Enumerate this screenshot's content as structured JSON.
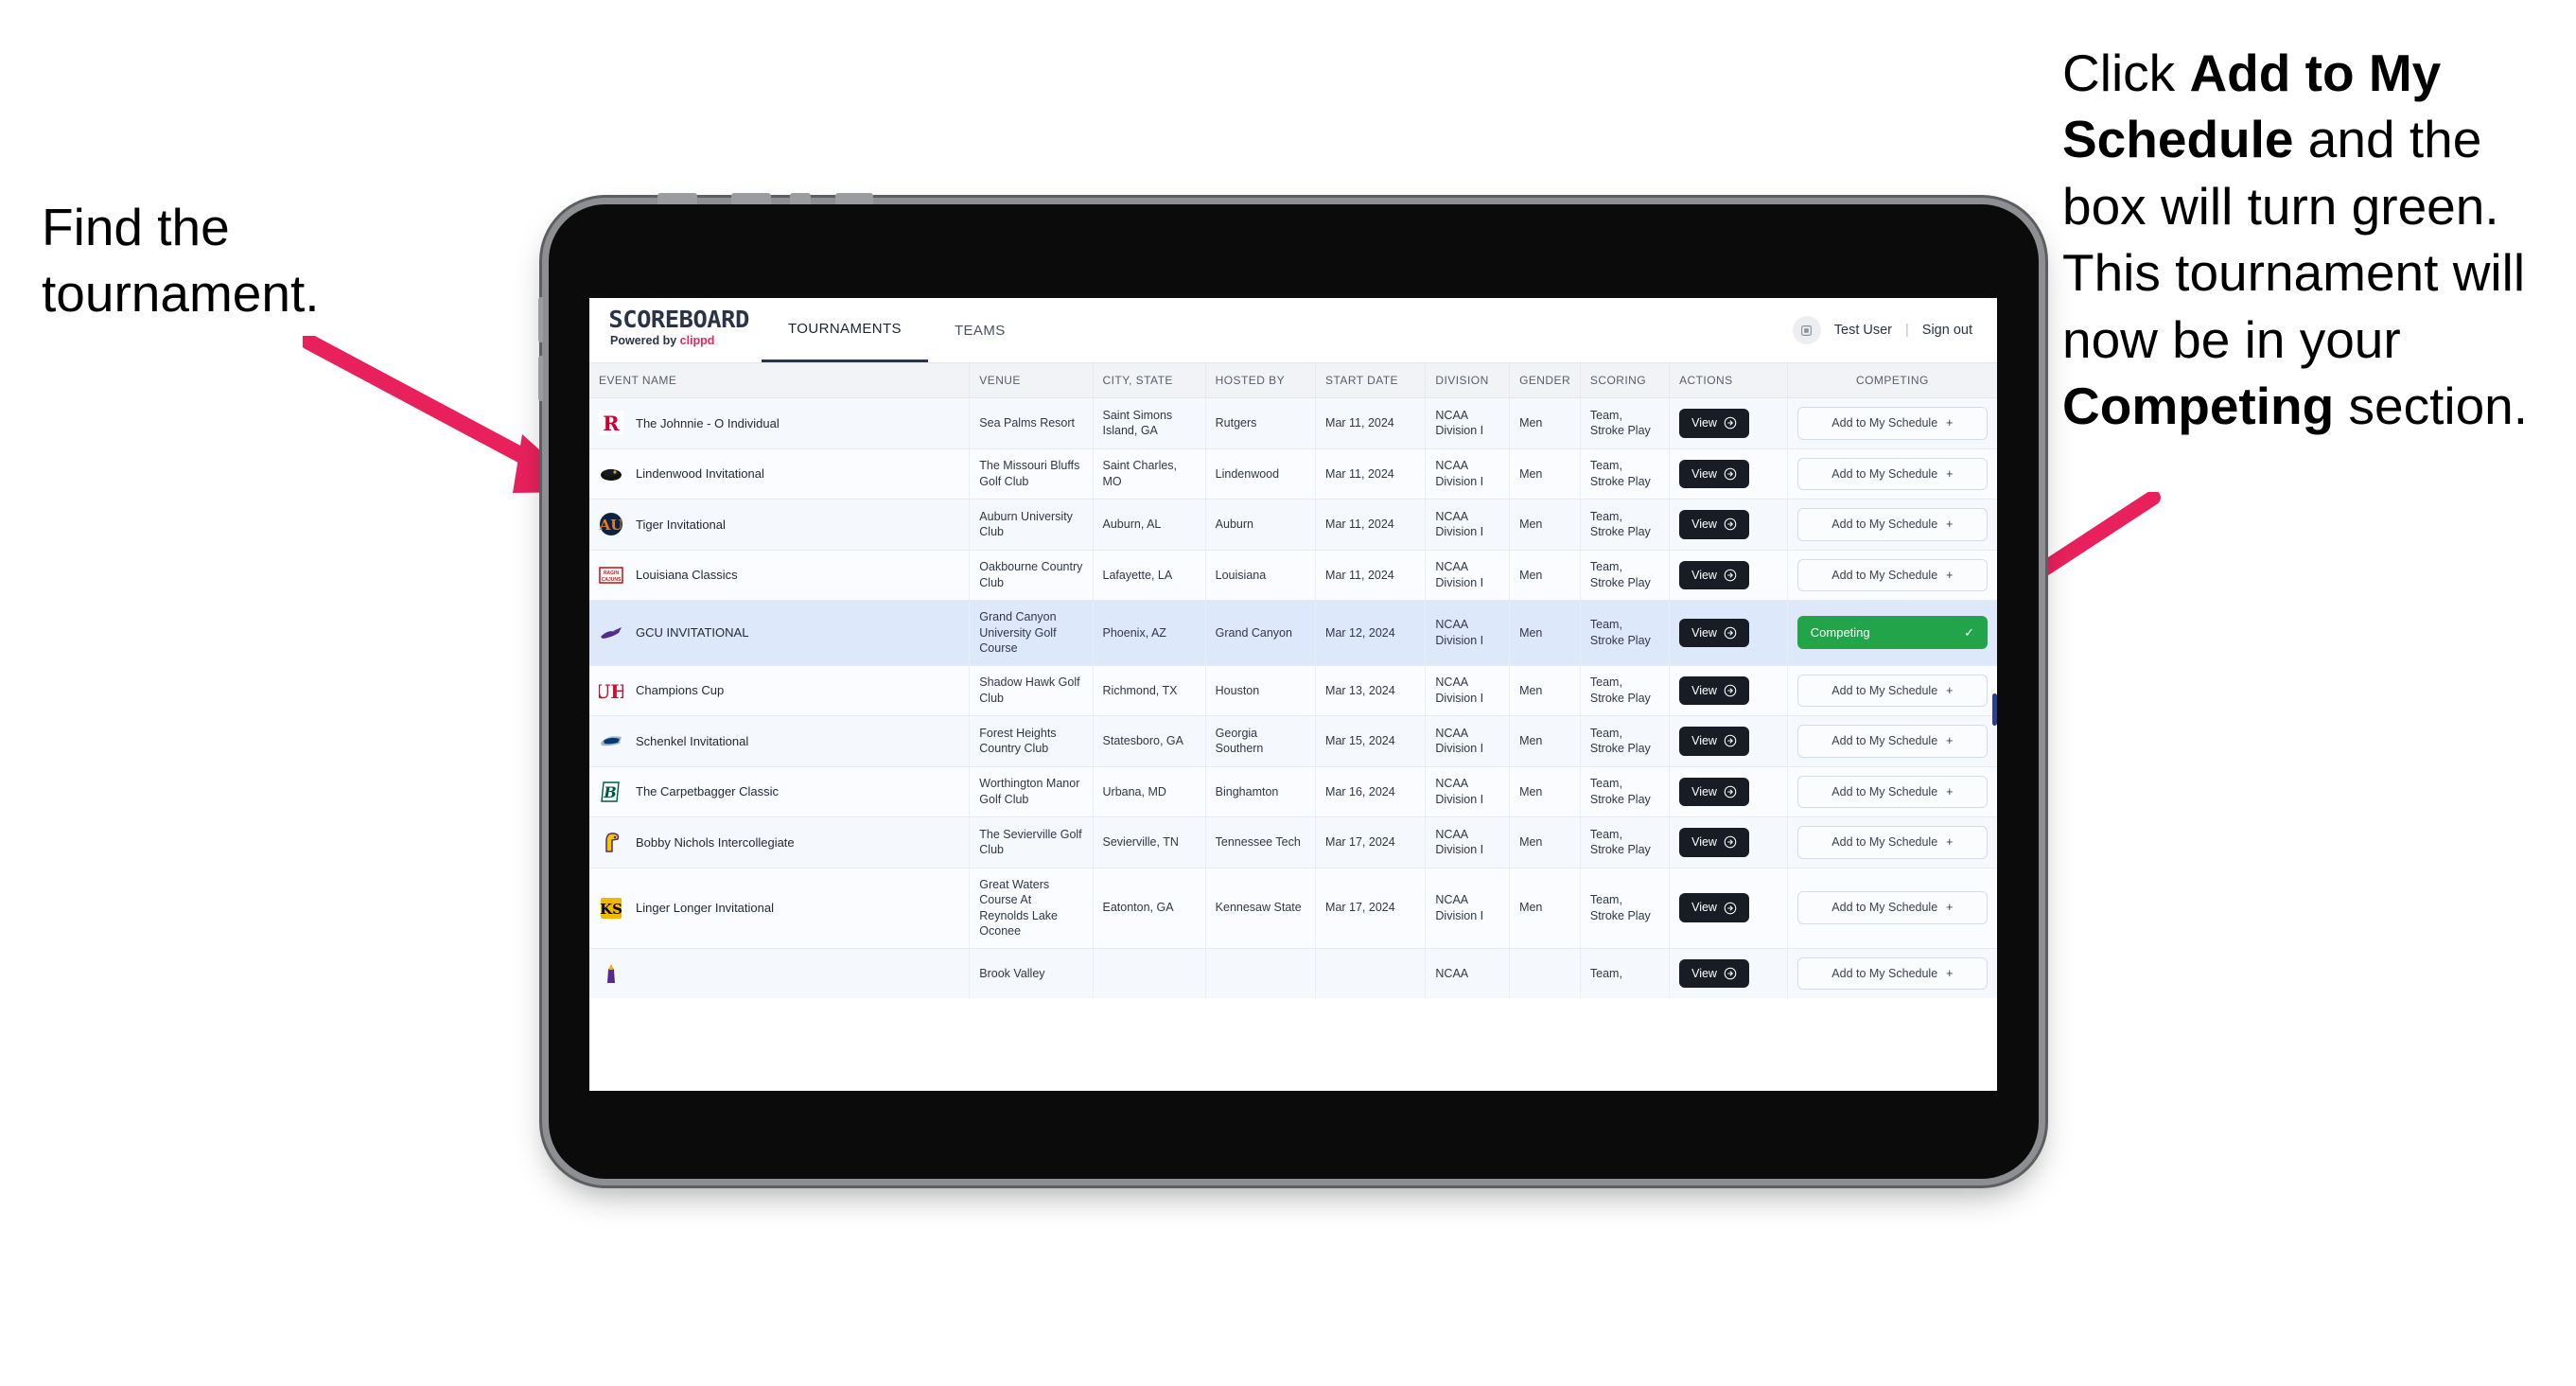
{
  "annotations": {
    "left": "Find the tournament.",
    "right_parts": [
      {
        "t": "Click ",
        "b": false
      },
      {
        "t": "Add to My Schedule",
        "b": true
      },
      {
        "t": " and the box will turn green. This tournament will now be in your ",
        "b": false
      },
      {
        "t": "Competing",
        "b": true
      },
      {
        "t": " section.",
        "b": false
      }
    ],
    "arrow_color": "#e8215c"
  },
  "app": {
    "brand": {
      "title": "SCOREBOARD",
      "powered_prefix": "Powered by ",
      "powered_brand": "clippd"
    },
    "nav": [
      {
        "label": "TOURNAMENTS",
        "active": true
      },
      {
        "label": "TEAMS",
        "active": false
      }
    ],
    "user": {
      "avatar_icon": "user-avatar-icon",
      "name": "Test User",
      "separator": "|",
      "signout": "Sign out"
    },
    "columns": [
      "EVENT NAME",
      "VENUE",
      "CITY, STATE",
      "HOSTED BY",
      "START DATE",
      "DIVISION",
      "GENDER",
      "SCORING",
      "ACTIONS",
      "COMPETING"
    ],
    "labels": {
      "view": "View",
      "add": "Add to My Schedule",
      "add_plus": "+",
      "competing": "Competing",
      "check": "✓"
    },
    "accent": {
      "green": "#22a54a",
      "dark": "#181c24",
      "selected_row": "#dde8fb",
      "clippd_pink": "#f0245d"
    },
    "rows": [
      {
        "logo": "rutgers-logo",
        "name": "The Johnnie - O Individual",
        "venue": "Sea Palms Resort",
        "city": "Saint Simons Island, GA",
        "host": "Rutgers",
        "date": "Mar 11, 2024",
        "division": "NCAA Division I",
        "gender": "Men",
        "scoring": "Team, Stroke Play",
        "competing": false,
        "selected": false
      },
      {
        "logo": "lindenwood-logo",
        "name": "Lindenwood Invitational",
        "venue": "The Missouri Bluffs Golf Club",
        "city": "Saint Charles, MO",
        "host": "Lindenwood",
        "date": "Mar 11, 2024",
        "division": "NCAA Division I",
        "gender": "Men",
        "scoring": "Team, Stroke Play",
        "competing": false,
        "selected": false
      },
      {
        "logo": "auburn-logo",
        "name": "Tiger Invitational",
        "venue": "Auburn University Club",
        "city": "Auburn, AL",
        "host": "Auburn",
        "date": "Mar 11, 2024",
        "division": "NCAA Division I",
        "gender": "Men",
        "scoring": "Team, Stroke Play",
        "competing": false,
        "selected": false
      },
      {
        "logo": "louisiana-logo",
        "name": "Louisiana Classics",
        "venue": "Oakbourne Country Club",
        "city": "Lafayette, LA",
        "host": "Louisiana",
        "date": "Mar 11, 2024",
        "division": "NCAA Division I",
        "gender": "Men",
        "scoring": "Team, Stroke Play",
        "competing": false,
        "selected": false
      },
      {
        "logo": "grandcanyon-logo",
        "name": "GCU INVITATIONAL",
        "venue": "Grand Canyon University Golf Course",
        "city": "Phoenix, AZ",
        "host": "Grand Canyon",
        "date": "Mar 12, 2024",
        "division": "NCAA Division I",
        "gender": "Men",
        "scoring": "Team, Stroke Play",
        "competing": true,
        "selected": true
      },
      {
        "logo": "houston-logo",
        "name": "Champions Cup",
        "venue": "Shadow Hawk Golf Club",
        "city": "Richmond, TX",
        "host": "Houston",
        "date": "Mar 13, 2024",
        "division": "NCAA Division I",
        "gender": "Men",
        "scoring": "Team, Stroke Play",
        "competing": false,
        "selected": false
      },
      {
        "logo": "georgiasouthern-logo",
        "name": "Schenkel Invitational",
        "venue": "Forest Heights Country Club",
        "city": "Statesboro, GA",
        "host": "Georgia Southern",
        "date": "Mar 15, 2024",
        "division": "NCAA Division I",
        "gender": "Men",
        "scoring": "Team, Stroke Play",
        "competing": false,
        "selected": false
      },
      {
        "logo": "binghamton-logo",
        "name": "The Carpetbagger Classic",
        "venue": "Worthington Manor Golf Club",
        "city": "Urbana, MD",
        "host": "Binghamton",
        "date": "Mar 16, 2024",
        "division": "NCAA Division I",
        "gender": "Men",
        "scoring": "Team, Stroke Play",
        "competing": false,
        "selected": false
      },
      {
        "logo": "tennesseetech-logo",
        "name": "Bobby Nichols Intercollegiate",
        "venue": "The Sevierville Golf Club",
        "city": "Sevierville, TN",
        "host": "Tennessee Tech",
        "date": "Mar 17, 2024",
        "division": "NCAA Division I",
        "gender": "Men",
        "scoring": "Team, Stroke Play",
        "competing": false,
        "selected": false
      },
      {
        "logo": "kennesawstate-logo",
        "name": "Linger Longer Invitational",
        "venue": "Great Waters Course At Reynolds Lake Oconee",
        "city": "Eatonton, GA",
        "host": "Kennesaw State",
        "date": "Mar 17, 2024",
        "division": "NCAA Division I",
        "gender": "Men",
        "scoring": "Team, Stroke Play",
        "competing": false,
        "selected": false
      },
      {
        "logo": "eastcarolina-logo",
        "name": "",
        "venue": "Brook Valley",
        "city": "",
        "host": "",
        "date": "",
        "division": "NCAA",
        "gender": "",
        "scoring": "Team,",
        "competing": false,
        "selected": false
      }
    ]
  }
}
